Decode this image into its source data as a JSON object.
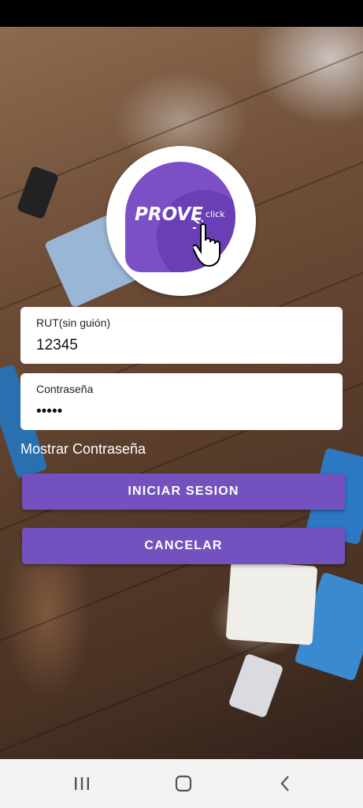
{
  "logo": {
    "brand_word": "PROVE",
    "brand_suffix": "click",
    "icon": "pointing-hand-icon",
    "colors": {
      "primary": "#7b4fc6",
      "secondary": "#6a3fb6"
    }
  },
  "form": {
    "rut_label": "RUT(sin guión)",
    "rut_value": "12345",
    "password_label": "Contraseña",
    "password_value": "•••••",
    "show_password_label": "Mostrar Contraseña"
  },
  "buttons": {
    "login_label": "INICIAR SESION",
    "cancel_label": "CANCELAR",
    "color": "#7352c0"
  },
  "nav_bar": {
    "icons": [
      "recent-apps-icon",
      "home-icon",
      "back-icon"
    ]
  }
}
